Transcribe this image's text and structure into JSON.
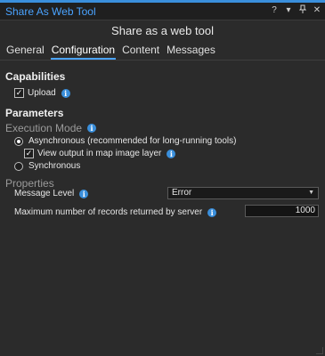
{
  "pane": {
    "title": "Share As Web Tool",
    "controls": {
      "help": "?",
      "menu": "▾",
      "pin": "📌",
      "close": "✕"
    }
  },
  "dialog": {
    "title": "Share as a web tool"
  },
  "tabs": [
    {
      "label": "General",
      "active": false
    },
    {
      "label": "Configuration",
      "active": true
    },
    {
      "label": "Content",
      "active": false
    },
    {
      "label": "Messages",
      "active": false
    }
  ],
  "capabilities": {
    "heading": "Capabilities",
    "upload": {
      "label": "Upload",
      "checked": true,
      "info_icon": "info-icon"
    }
  },
  "parameters": {
    "heading": "Parameters",
    "execution_mode": {
      "label": "Execution Mode",
      "async_label": "Asynchronous (recommended for long-running tools)",
      "async_selected": true,
      "view_output_label": "View output in map image layer",
      "view_output_checked": true,
      "sync_label": "Synchronous",
      "sync_selected": false
    },
    "properties": {
      "label": "Properties",
      "message_level": {
        "label": "Message Level",
        "value": "Error"
      },
      "max_records": {
        "label": "Maximum number of records returned by server",
        "value": "1000"
      }
    }
  },
  "colors": {
    "accent": "#4aa3ff",
    "background": "#2b2b2b",
    "info": "#3a8fdc"
  }
}
